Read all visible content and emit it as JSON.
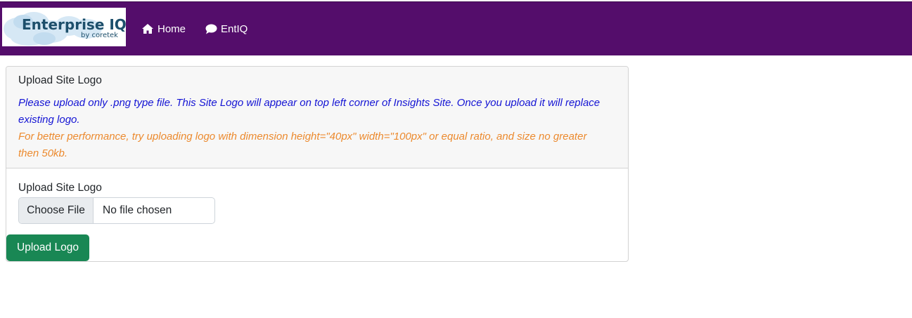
{
  "navbar": {
    "logo_title": "Enterprise IQ",
    "logo_subtitle": "by coretek",
    "items": [
      {
        "label": "Home",
        "icon": "home-icon"
      },
      {
        "label": "EntIQ",
        "icon": "chat-bubble-icon"
      }
    ],
    "background_color": "#540d6b"
  },
  "card": {
    "title": "Upload Site Logo",
    "note_primary": "Please upload only .png type file. This Site Logo will appear on top left corner of Insights Site. Once you upload it will replace existing logo.",
    "note_secondary": "For better performance, try uploading logo with dimension height=\"40px\" width=\"100px\" or equal ratio, and size no greater then 50kb.",
    "field_label": "Upload Site Logo",
    "file_button_label": "Choose File",
    "file_status": "No file chosen",
    "submit_label": "Upload Logo",
    "note_primary_color": "#1414d4",
    "note_secondary_color": "#ec8a2e",
    "submit_color": "#198754"
  }
}
